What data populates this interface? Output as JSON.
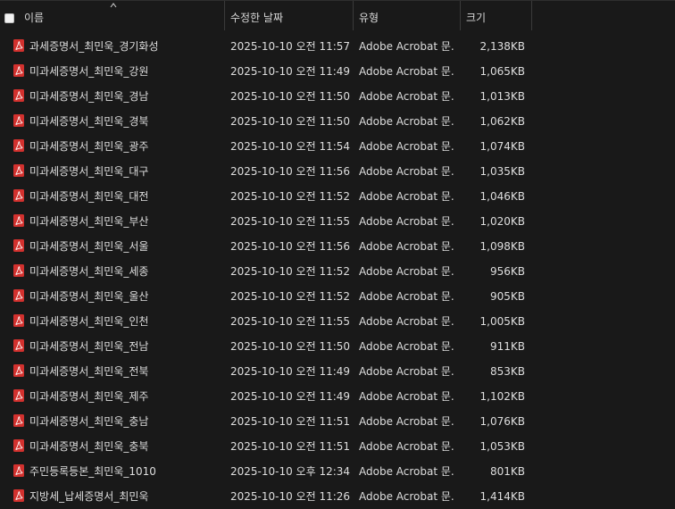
{
  "header": {
    "name": "이름",
    "modified": "수정한 날짜",
    "type": "유형",
    "size": "크기"
  },
  "files": [
    {
      "name": "과세증명서_최민욱_경기화성",
      "modified": "2025-10-10 오전 11:57",
      "type": "Adobe Acrobat 문...",
      "size": "2,138KB"
    },
    {
      "name": "미과세증명서_최민욱_강원",
      "modified": "2025-10-10 오전 11:49",
      "type": "Adobe Acrobat 문...",
      "size": "1,065KB"
    },
    {
      "name": "미과세증명서_최민욱_경남",
      "modified": "2025-10-10 오전 11:50",
      "type": "Adobe Acrobat 문...",
      "size": "1,013KB"
    },
    {
      "name": "미과세증명서_최민욱_경북",
      "modified": "2025-10-10 오전 11:50",
      "type": "Adobe Acrobat 문...",
      "size": "1,062KB"
    },
    {
      "name": "미과세증명서_최민욱_광주",
      "modified": "2025-10-10 오전 11:54",
      "type": "Adobe Acrobat 문...",
      "size": "1,074KB"
    },
    {
      "name": "미과세증명서_최민욱_대구",
      "modified": "2025-10-10 오전 11:56",
      "type": "Adobe Acrobat 문...",
      "size": "1,035KB"
    },
    {
      "name": "미과세증명서_최민욱_대전",
      "modified": "2025-10-10 오전 11:52",
      "type": "Adobe Acrobat 문...",
      "size": "1,046KB"
    },
    {
      "name": "미과세증명서_최민욱_부산",
      "modified": "2025-10-10 오전 11:55",
      "type": "Adobe Acrobat 문...",
      "size": "1,020KB"
    },
    {
      "name": "미과세증명서_최민욱_서울",
      "modified": "2025-10-10 오전 11:56",
      "type": "Adobe Acrobat 문...",
      "size": "1,098KB"
    },
    {
      "name": "미과세증명서_최민욱_세종",
      "modified": "2025-10-10 오전 11:52",
      "type": "Adobe Acrobat 문...",
      "size": "956KB"
    },
    {
      "name": "미과세증명서_최민욱_울산",
      "modified": "2025-10-10 오전 11:52",
      "type": "Adobe Acrobat 문...",
      "size": "905KB"
    },
    {
      "name": "미과세증명서_최민욱_인천",
      "modified": "2025-10-10 오전 11:55",
      "type": "Adobe Acrobat 문...",
      "size": "1,005KB"
    },
    {
      "name": "미과세증명서_최민욱_전남",
      "modified": "2025-10-10 오전 11:50",
      "type": "Adobe Acrobat 문...",
      "size": "911KB"
    },
    {
      "name": "미과세증명서_최민욱_전북",
      "modified": "2025-10-10 오전 11:49",
      "type": "Adobe Acrobat 문...",
      "size": "853KB"
    },
    {
      "name": "미과세증명서_최민욱_제주",
      "modified": "2025-10-10 오전 11:49",
      "type": "Adobe Acrobat 문...",
      "size": "1,102KB"
    },
    {
      "name": "미과세증명서_최민욱_충남",
      "modified": "2025-10-10 오전 11:51",
      "type": "Adobe Acrobat 문...",
      "size": "1,076KB"
    },
    {
      "name": "미과세증명서_최민욱_충북",
      "modified": "2025-10-10 오전 11:51",
      "type": "Adobe Acrobat 문...",
      "size": "1,053KB"
    },
    {
      "name": "주민등록등본_최민욱_1010",
      "modified": "2025-10-10 오후 12:34",
      "type": "Adobe Acrobat 문...",
      "size": "801KB"
    },
    {
      "name": "지방세_납세증명서_최민욱",
      "modified": "2025-10-10 오전 11:26",
      "type": "Adobe Acrobat 문...",
      "size": "1,414KB"
    }
  ],
  "icons": {
    "file": "pdf-file-icon",
    "sort": "sort-up-icon"
  },
  "colors": {
    "background": "#191919",
    "pdf_icon": "#d2312e",
    "text": "#dedede"
  }
}
